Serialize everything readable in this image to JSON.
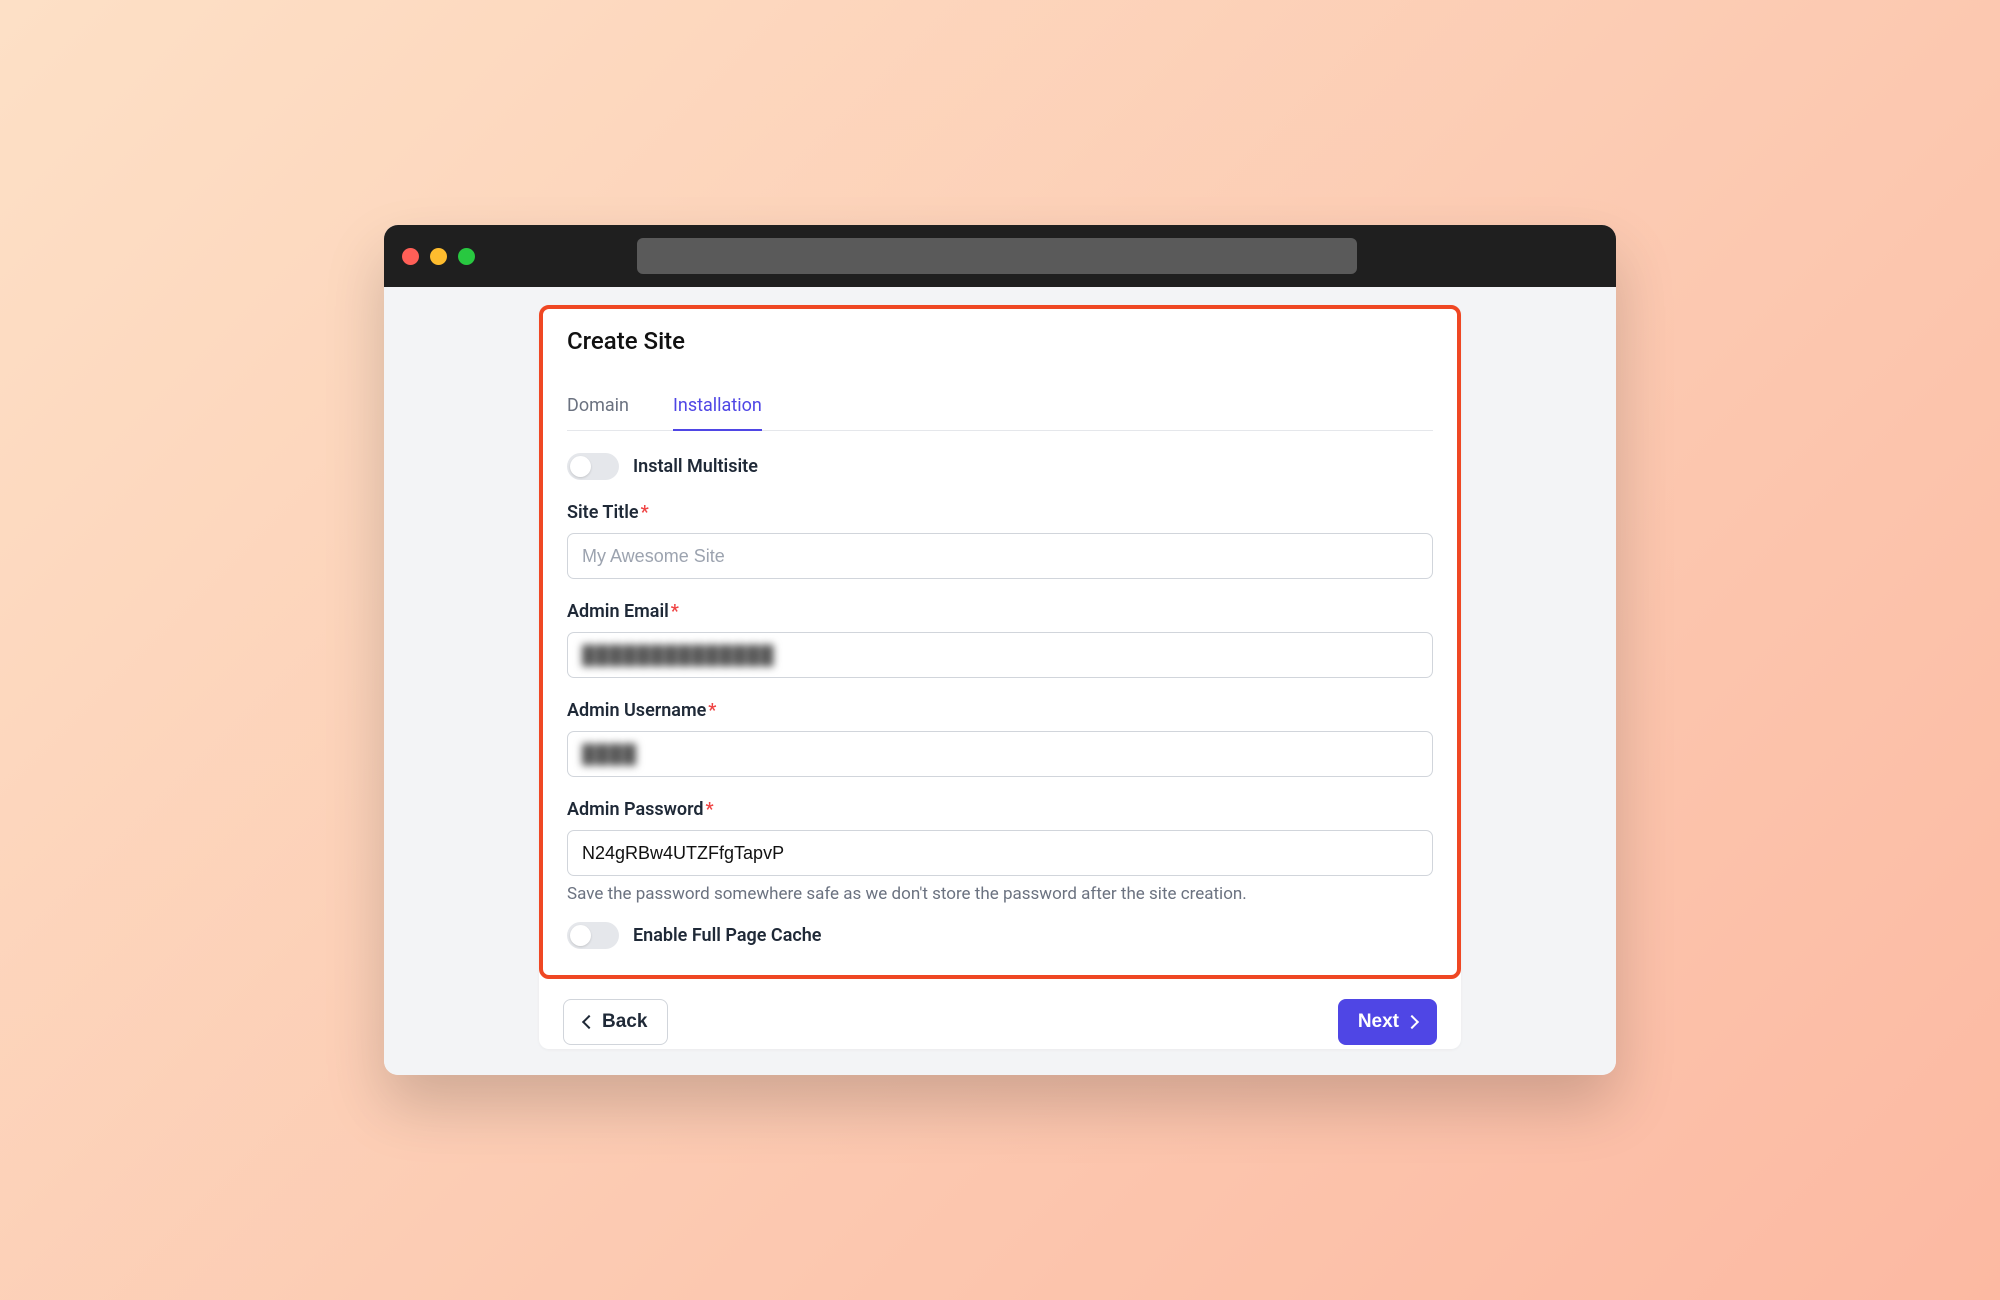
{
  "page": {
    "title": "Create Site"
  },
  "tabs": [
    {
      "label": "Domain",
      "active": false
    },
    {
      "label": "Installation",
      "active": true
    }
  ],
  "toggles": {
    "multisite": {
      "label": "Install Multisite",
      "on": false
    },
    "cache": {
      "label": "Enable Full Page Cache",
      "on": false
    }
  },
  "fields": {
    "site_title": {
      "label": "Site Title",
      "required": true,
      "placeholder": "My Awesome Site",
      "value": ""
    },
    "admin_email": {
      "label": "Admin Email",
      "required": true,
      "value": "██████████████"
    },
    "admin_username": {
      "label": "Admin Username",
      "required": true,
      "value": "████"
    },
    "admin_password": {
      "label": "Admin Password",
      "required": true,
      "value": "N24gRBw4UTZFfgTapvP",
      "help": "Save the password somewhere safe as we don't store the password after the site creation."
    }
  },
  "buttons": {
    "back": "Back",
    "next": "Next"
  }
}
